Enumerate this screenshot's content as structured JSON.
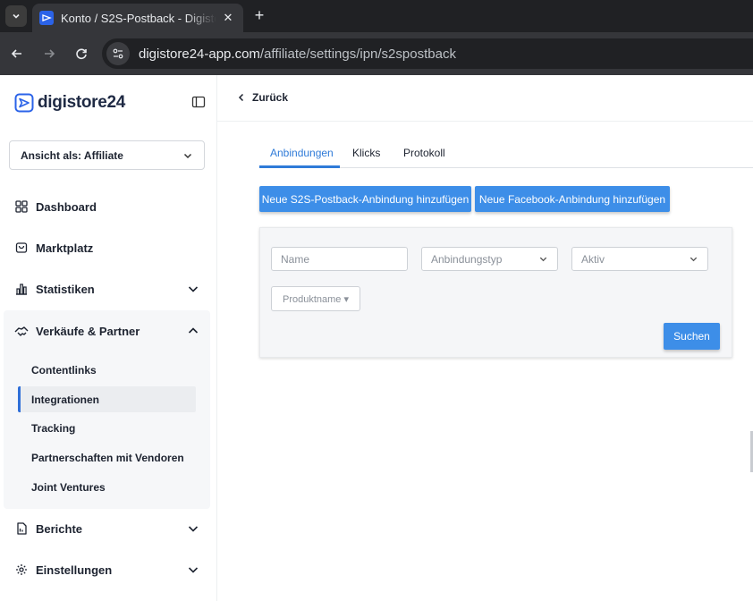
{
  "browser": {
    "tab_title": "Konto / S2S-Postback - Digistore24",
    "url_host": "digistore24-app.com",
    "url_path": "/affiliate/settings/ipn/s2spostback"
  },
  "sidebar": {
    "logo_text": "digistore24",
    "role_label": "Ansicht als: Affiliate",
    "items": [
      {
        "label": "Dashboard",
        "icon": "grid-icon"
      },
      {
        "label": "Marktplatz",
        "icon": "store-icon"
      },
      {
        "label": "Statistiken",
        "icon": "bar-chart-icon"
      },
      {
        "label": "Verkäufe & Partner",
        "icon": "handshake-icon"
      },
      {
        "label": "Berichte",
        "icon": "document-icon"
      },
      {
        "label": "Einstellungen",
        "icon": "gear-icon"
      }
    ],
    "sub_items": [
      {
        "label": "Contentlinks"
      },
      {
        "label": "Integrationen"
      },
      {
        "label": "Tracking"
      },
      {
        "label": "Partnerschaften mit Vendoren"
      },
      {
        "label": "Joint Ventures"
      }
    ]
  },
  "main": {
    "back_label": "Zurück",
    "tabs": [
      {
        "label": "Anbindungen"
      },
      {
        "label": "Klicks"
      },
      {
        "label": "Protokoll"
      }
    ],
    "add_s2s_label": "Neue S2S-Postback-Anbindung hinzufügen",
    "add_facebook_label": "Neue Facebook-Anbindung hinzufügen",
    "filter": {
      "name_placeholder": "Name",
      "type_placeholder": "Anbindungstyp",
      "active_placeholder": "Aktiv",
      "product_label": "Produktname ▾",
      "search_label": "Suchen"
    }
  },
  "colors": {
    "accent": "#3d8ee8",
    "tab_active": "#2f7bd8",
    "text": "#1d2330"
  }
}
